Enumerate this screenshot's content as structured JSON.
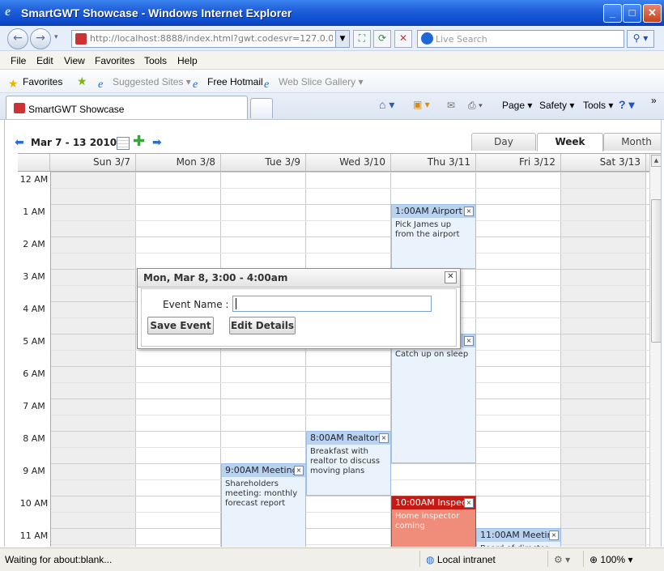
{
  "window": {
    "title": "SmartGWT Showcase - Windows Internet Explorer"
  },
  "address": {
    "url": "http://localhost:8888/index.html?gwt.codesvr=127.0.0.1:999"
  },
  "search": {
    "placeholder": "Live Search"
  },
  "menu": [
    "File",
    "Edit",
    "View",
    "Favorites",
    "Tools",
    "Help"
  ],
  "favorites": {
    "label": "Favorites",
    "items": [
      "Suggested Sites ▾",
      "Free Hotmail",
      "Web Slice Gallery ▾"
    ]
  },
  "tab": {
    "title": "SmartGWT Showcase"
  },
  "toolbar": {
    "page": "Page ▾",
    "safety": "Safety ▾",
    "tools": "Tools ▾"
  },
  "calendar": {
    "date_range": "Mar 7 - 13 2010",
    "view_tabs": [
      "Day",
      "Week",
      "Month"
    ],
    "selected_view": "Week",
    "day_headers": [
      "Sun 3/7",
      "Mon 3/8",
      "Tue 3/9",
      "Wed 3/10",
      "Thu 3/11",
      "Fri 3/12",
      "Sat 3/13"
    ],
    "hours": [
      "12 AM",
      "1 AM",
      "2 AM",
      "3 AM",
      "4 AM",
      "5 AM",
      "6 AM",
      "7 AM",
      "8 AM",
      "9 AM",
      "10 AM",
      "11 AM"
    ],
    "events": [
      {
        "day": 4,
        "start": 1,
        "end": 3,
        "title": "1:00AM Airport r",
        "body": "Pick James up from the airport",
        "style": "blue"
      },
      {
        "day": 4,
        "start": 5,
        "end": 9,
        "title": "",
        "body": "Catch up on sleep",
        "style": "blue"
      },
      {
        "day": 3,
        "start": 8,
        "end": 10,
        "title": "8:00AM Realtor",
        "body": "Breakfast with realtor to discuss moving plans",
        "style": "blue"
      },
      {
        "day": 2,
        "start": 9,
        "end": 12.6,
        "title": "9:00AM Meeting",
        "body": "Shareholders meeting: monthly forecast report",
        "style": "blue"
      },
      {
        "day": 4,
        "start": 10,
        "end": 12.6,
        "title": "10:00AM Inspect",
        "body": "Home inspector coming",
        "style": "red"
      },
      {
        "day": 5,
        "start": 11,
        "end": 12.6,
        "title": "11:00AM Meetin",
        "body": "Board of director",
        "style": "blue"
      }
    ]
  },
  "dialog": {
    "title": "Mon, Mar 8, 3:00 - 4:00am",
    "field_label": "Event Name :",
    "field_value": "",
    "save_label": "Save Event",
    "edit_label": "Edit Details"
  },
  "status": {
    "text": "Waiting for about:blank...",
    "zone": "Local intranet",
    "zoom": "100%"
  }
}
